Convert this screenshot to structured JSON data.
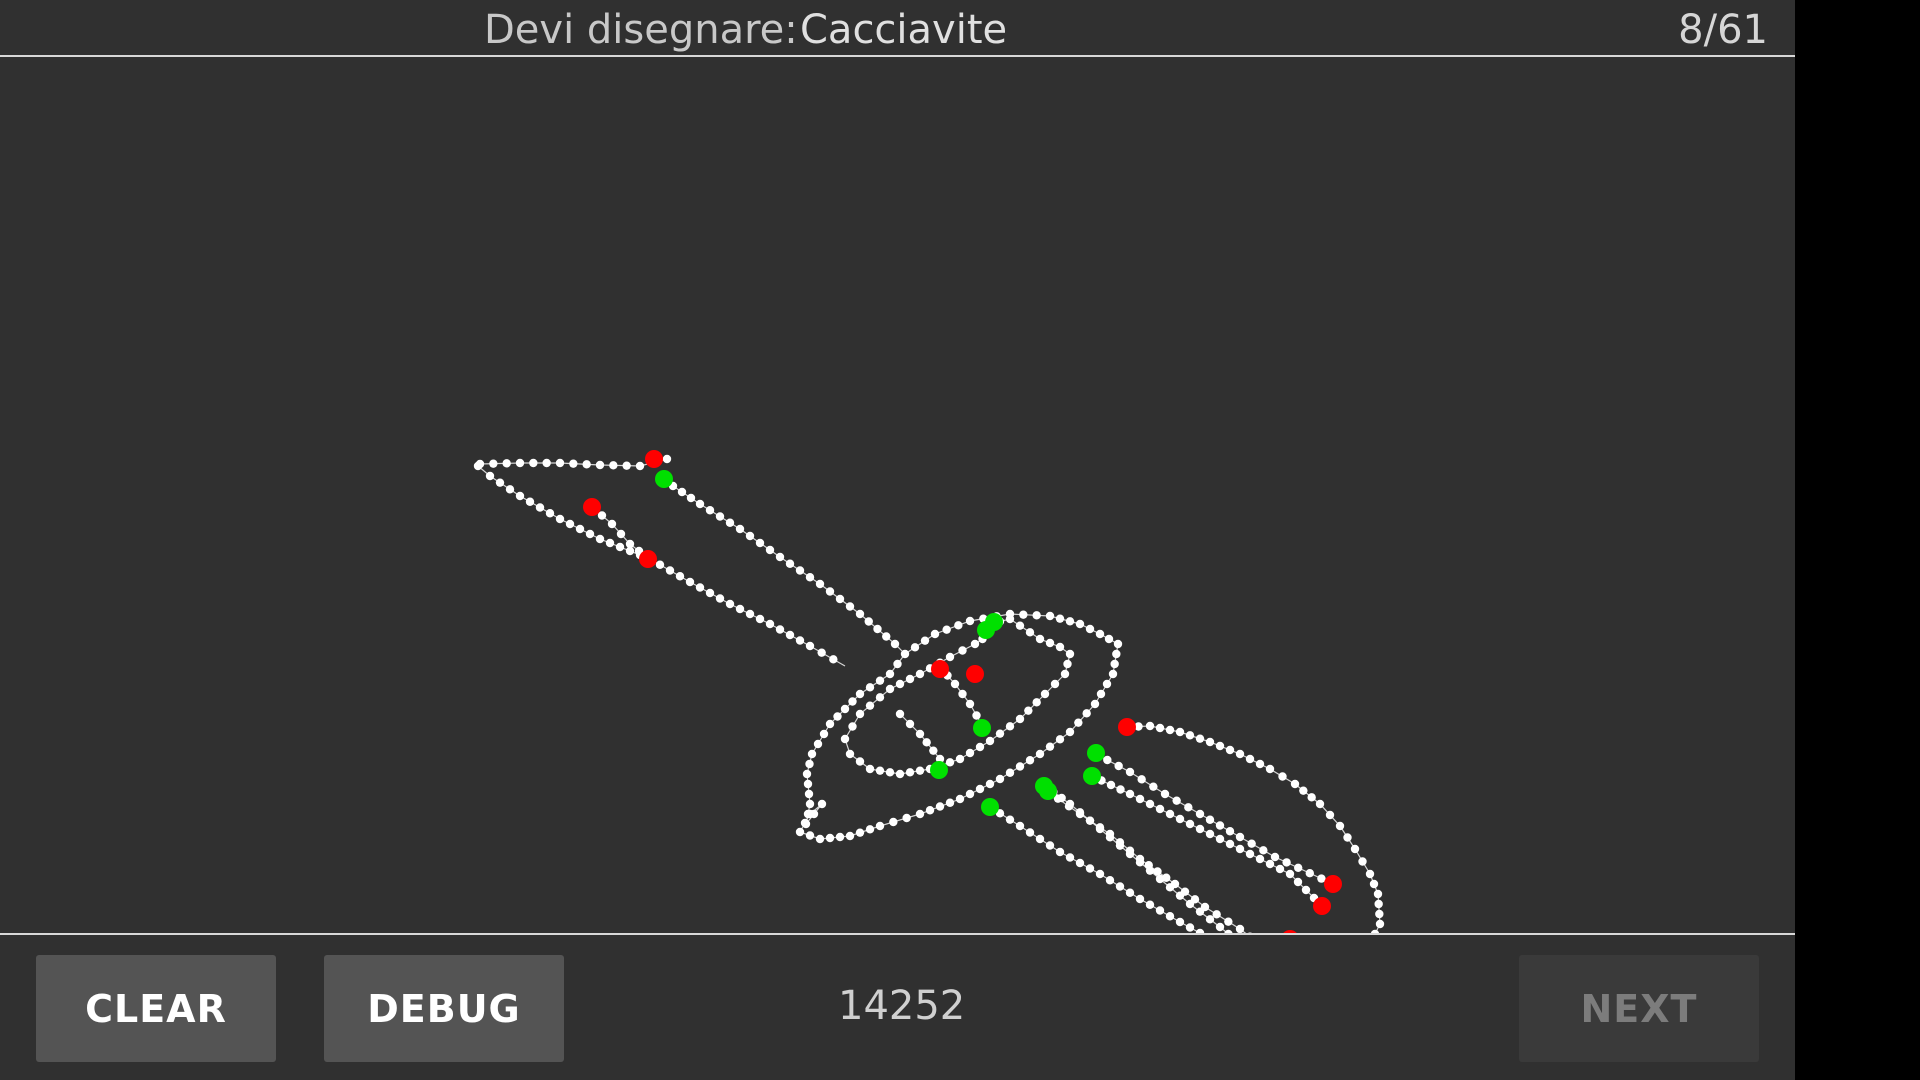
{
  "header": {
    "prompt_label": "Devi disegnare:",
    "prompt_word": "Cacciavite",
    "counter": "8/61"
  },
  "footer": {
    "clear_label": "CLEAR",
    "debug_label": "DEBUG",
    "score": "14252",
    "next_label": "NEXT",
    "next_enabled": false
  },
  "colors": {
    "background": "#303030",
    "stroke": "#ffffff",
    "start_marker": "#00e000",
    "end_marker": "#ff0000"
  }
}
